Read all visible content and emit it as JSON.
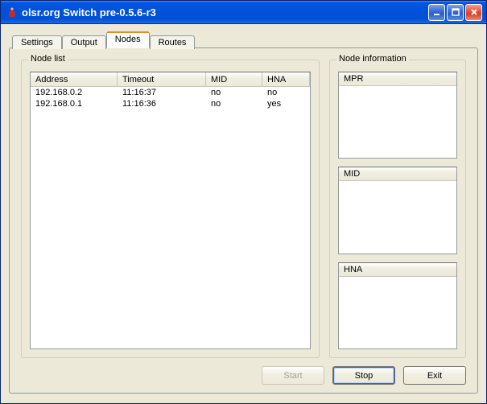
{
  "window": {
    "title": "olsr.org Switch pre-0.5.6-r3"
  },
  "tabs": {
    "settings": "Settings",
    "output": "Output",
    "nodes": "Nodes",
    "routes": "Routes"
  },
  "nodelist": {
    "label": "Node list",
    "columns": {
      "address": "Address",
      "timeout": "Timeout",
      "mid": "MID",
      "hna": "HNA"
    },
    "rows": [
      {
        "address": "192.168.0.2",
        "timeout": "11:16:37",
        "mid": "no",
        "hna": "no"
      },
      {
        "address": "192.168.0.1",
        "timeout": "11:16:36",
        "mid": "no",
        "hna": "yes"
      }
    ]
  },
  "nodeinfo": {
    "label": "Node information",
    "mpr": "MPR",
    "mid": "MID",
    "hna": "HNA"
  },
  "buttons": {
    "start": "Start",
    "stop": "Stop",
    "exit": "Exit"
  }
}
